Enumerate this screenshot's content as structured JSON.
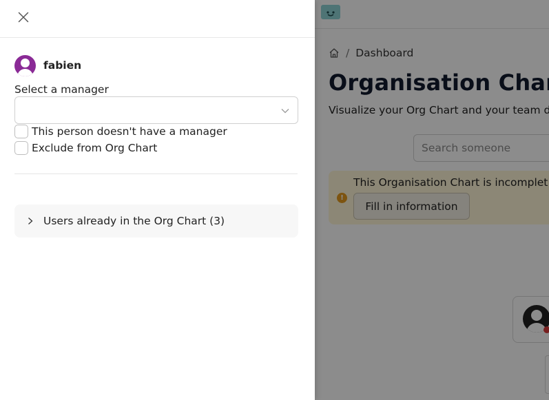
{
  "background": {
    "breadcrumb": {
      "home_icon": "home-icon",
      "separator": "/",
      "current": "Dashboard"
    },
    "title": "Organisation Chart",
    "subtitle": "Visualize your Org Chart and your team d",
    "search": {
      "placeholder": "Search someone"
    },
    "alert": {
      "icon": "!",
      "text": "This Organisation Chart is incomplet",
      "button_label": "Fill in information"
    }
  },
  "drawer": {
    "close_icon": "close-icon",
    "user": {
      "name": "fabien"
    },
    "manager": {
      "label": "Select a manager",
      "value": ""
    },
    "checkboxes": [
      {
        "label": "This person doesn't have a manager",
        "checked": false
      },
      {
        "label": "Exclude from Org Chart",
        "checked": false
      }
    ],
    "collapse": {
      "label": "Users already in the Org Chart (3)",
      "expanded": false
    }
  }
}
